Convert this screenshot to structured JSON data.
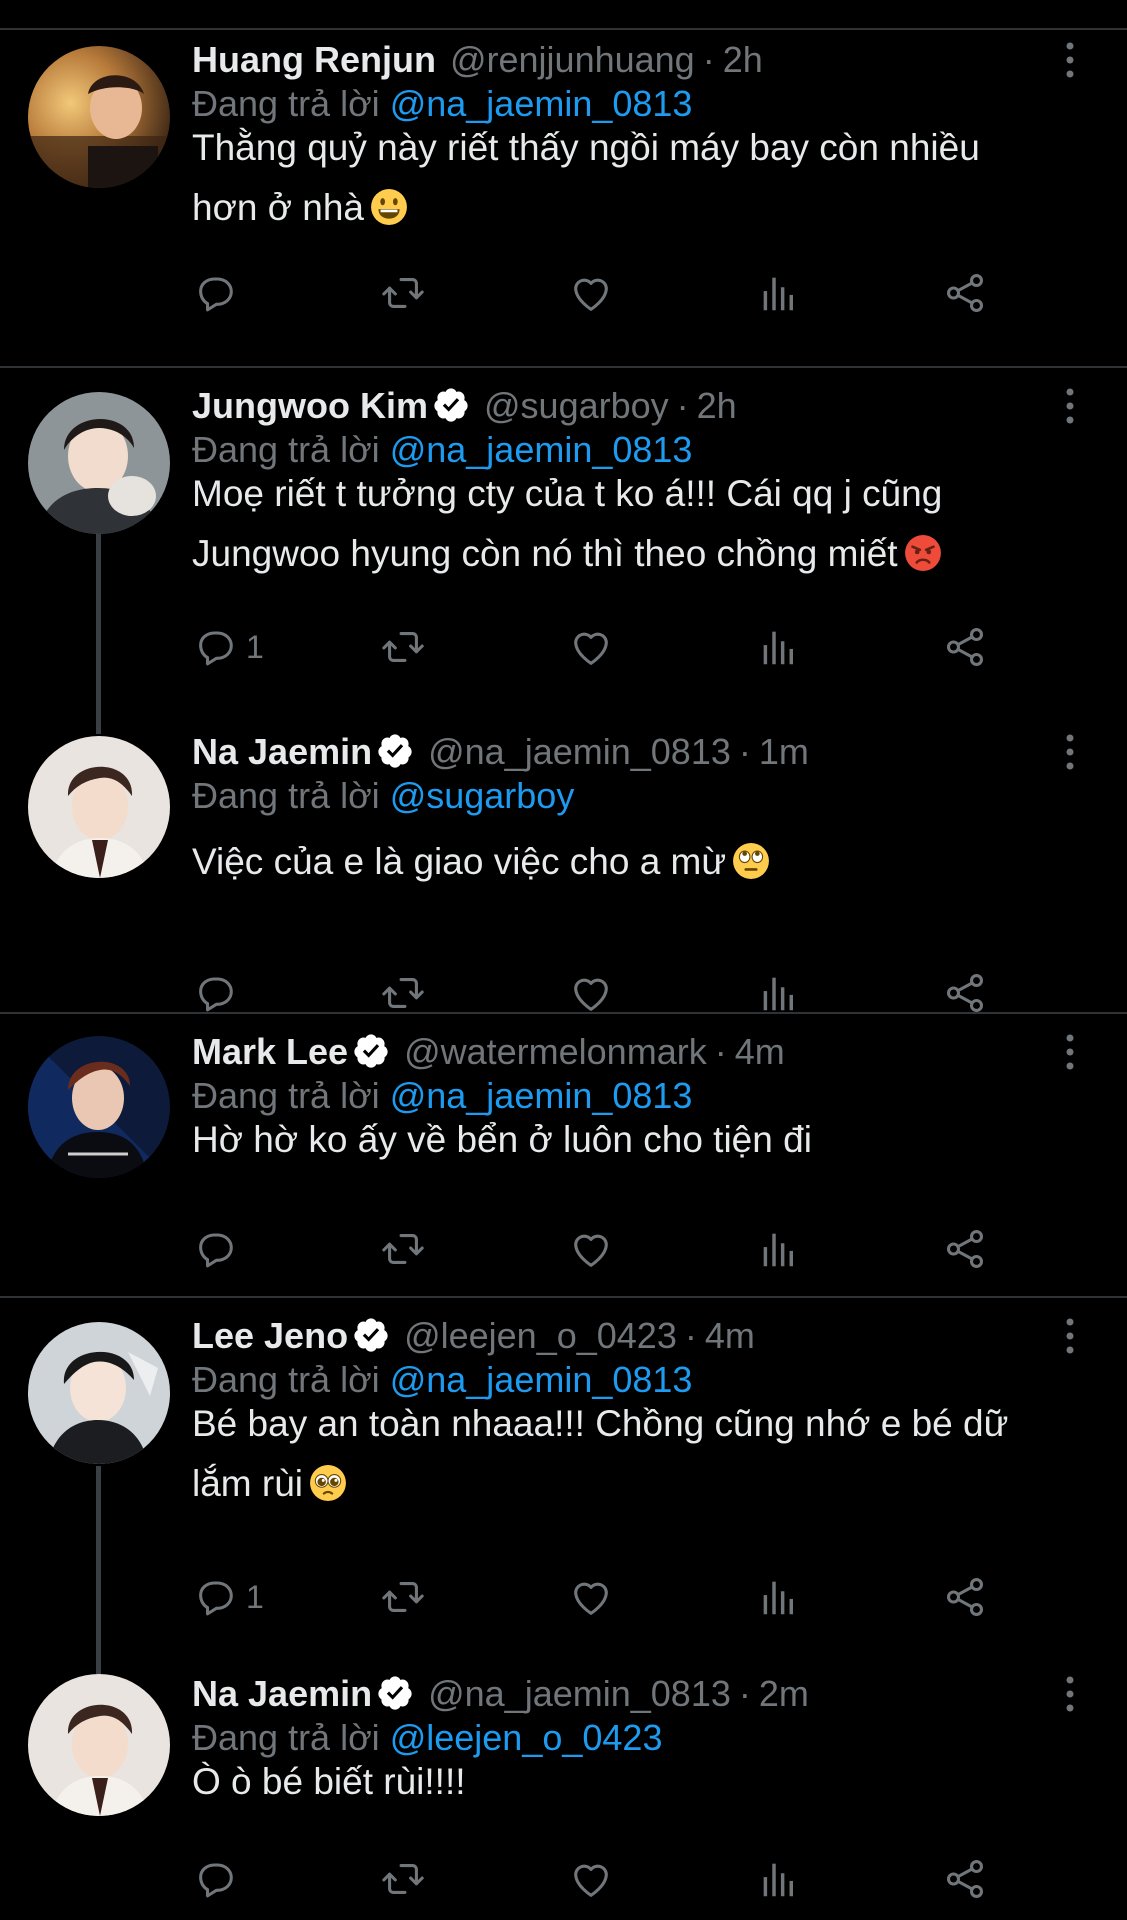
{
  "reply_prefix": "Đang trả lời",
  "colors": {
    "background": "#000000",
    "text": "#e7e9ea",
    "secondary": "#71767b",
    "mention": "#1d9bf0",
    "divider": "#2f3336",
    "verified_badge": "#ffffff"
  },
  "tweets": [
    {
      "name": "Huang Renjun",
      "verified": false,
      "handle": "@renjjunhuang",
      "time": "2h",
      "replying_to": "@na_jaemin_0813",
      "text_line1": "Thằng quỷ này riết thấy ngồi máy bay còn nhiều",
      "text_line2": "hơn ở nhà",
      "emoji": "grinning-face-emoji",
      "reply_count": ""
    },
    {
      "name": "Jungwoo Kim",
      "verified": true,
      "handle": "@sugarboy",
      "time": "2h",
      "replying_to": "@na_jaemin_0813",
      "text_line1": "Moẹ riết t tưởng cty của t ko á!!! Cái qq j cũng",
      "text_line2": "Jungwoo hyung còn nó thì theo chồng miết",
      "emoji": "angry-face-emoji",
      "reply_count": "1"
    },
    {
      "name": "Na Jaemin",
      "verified": true,
      "handle": "@na_jaemin_0813",
      "time": "1m",
      "replying_to": "@sugarboy",
      "text_line1": "Việc của e là giao việc cho a mừ",
      "emoji": "eye-roll-emoji",
      "reply_count": ""
    },
    {
      "name": "Mark Lee",
      "verified": true,
      "handle": "@watermelonmark",
      "time": "4m",
      "replying_to": "@na_jaemin_0813",
      "text_line1": "Hờ hờ ko ấy về bển ở luôn cho tiện đi",
      "reply_count": ""
    },
    {
      "name": "Lee Jeno",
      "verified": true,
      "handle": "@leejen_o_0423",
      "time": "4m",
      "replying_to": "@na_jaemin_0813",
      "text_line1": "Bé bay an toàn nhaaa!!! Chồng cũng nhớ e bé dữ",
      "text_line2": "lắm rùi",
      "emoji": "pleading-face-emoji",
      "reply_count": "1"
    },
    {
      "name": "Na Jaemin",
      "verified": true,
      "handle": "@na_jaemin_0813",
      "time": "2m",
      "replying_to": "@leejen_o_0423",
      "text_line1": "Ò ò bé biết rùi!!!!",
      "reply_count": ""
    }
  ],
  "action_icons": [
    "reply-icon",
    "retweet-icon",
    "like-icon",
    "analytics-icon",
    "share-icon"
  ]
}
